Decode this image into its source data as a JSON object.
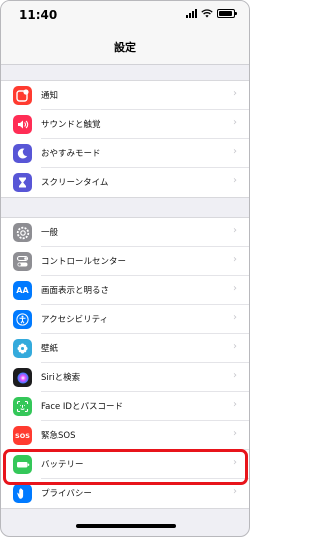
{
  "status_bar": {
    "time": "11:40",
    "battery_level": 0.9
  },
  "header": {
    "title": "設定"
  },
  "groups": [
    {
      "items": [
        {
          "id": "notifications",
          "label": "通知",
          "icon": "notification-icon",
          "color": "#ff3b30"
        },
        {
          "id": "sounds",
          "label": "サウンドと触覚",
          "icon": "speaker-icon",
          "color": "#ff2d55"
        },
        {
          "id": "dnd",
          "label": "おやすみモード",
          "icon": "moon-icon",
          "color": "#5856d6"
        },
        {
          "id": "screentime",
          "label": "スクリーンタイム",
          "icon": "hourglass-icon",
          "color": "#5856d6"
        }
      ]
    },
    {
      "items": [
        {
          "id": "general",
          "label": "一般",
          "icon": "gear-icon",
          "color": "#8e8e93"
        },
        {
          "id": "control-center",
          "label": "コントロールセンター",
          "icon": "toggles-icon",
          "color": "#8e8e93"
        },
        {
          "id": "display",
          "label": "画面表示と明るさ",
          "icon": "aa-icon",
          "icon_text": "AA",
          "color": "#007aff"
        },
        {
          "id": "accessibility",
          "label": "アクセシビリティ",
          "icon": "accessibility-icon",
          "color": "#007aff"
        },
        {
          "id": "wallpaper",
          "label": "壁紙",
          "icon": "flower-icon",
          "color": "#34aadc"
        },
        {
          "id": "siri",
          "label": "Siriと検索",
          "icon": "siri-icon",
          "color": "#1c1c1e"
        },
        {
          "id": "faceid",
          "label": "Face IDとパスコード",
          "icon": "face-id-icon",
          "color": "#34c759"
        },
        {
          "id": "sos",
          "label": "緊急SOS",
          "icon": "sos-icon",
          "icon_text": "SOS",
          "color": "#ff3b30"
        },
        {
          "id": "battery",
          "label": "バッテリー",
          "icon": "battery-icon",
          "color": "#34c759"
        },
        {
          "id": "privacy",
          "label": "プライバシー",
          "icon": "hand-icon",
          "color": "#007aff"
        }
      ]
    }
  ],
  "chevron": "›",
  "highlight_color": "#e8141b"
}
